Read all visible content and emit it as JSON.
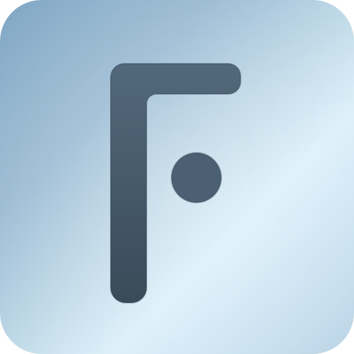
{
  "icon": {
    "name": "app-logo-icon",
    "colors": {
      "background_light": "#dcf0fb",
      "background_dark": "#7fa6c3",
      "glyph_top": "#52697b",
      "glyph_bottom": "#3a4a59"
    }
  }
}
